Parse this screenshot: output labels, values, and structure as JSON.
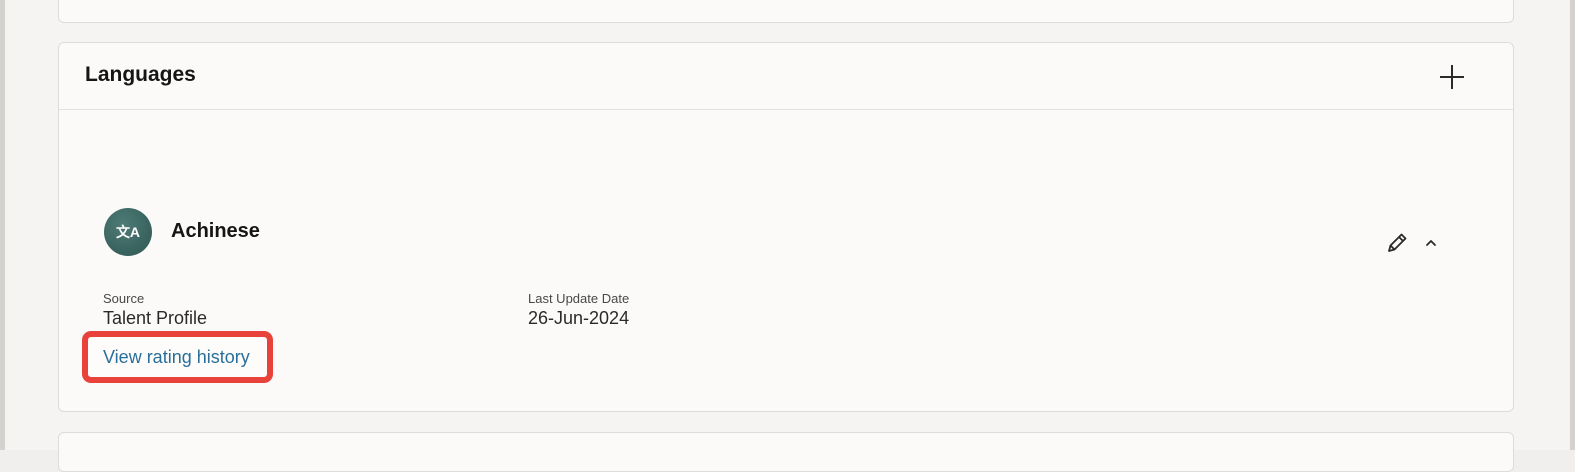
{
  "section": {
    "title": "Languages",
    "add_icon": "plus-icon"
  },
  "language_item": {
    "name": "Achinese",
    "avatar_icon": "translate-icon",
    "avatar_glyph": "文A",
    "edit_icon": "pencil-icon",
    "collapse_icon": "chevron-up-icon",
    "source_label": "Source",
    "source_value": "Talent Profile",
    "date_label": "Last Update Date",
    "date_value": "26-Jun-2024",
    "history_link": "View rating history"
  },
  "colors": {
    "link": "#2a6f99",
    "avatar": "#3a6460",
    "highlight": "#e8423b"
  }
}
